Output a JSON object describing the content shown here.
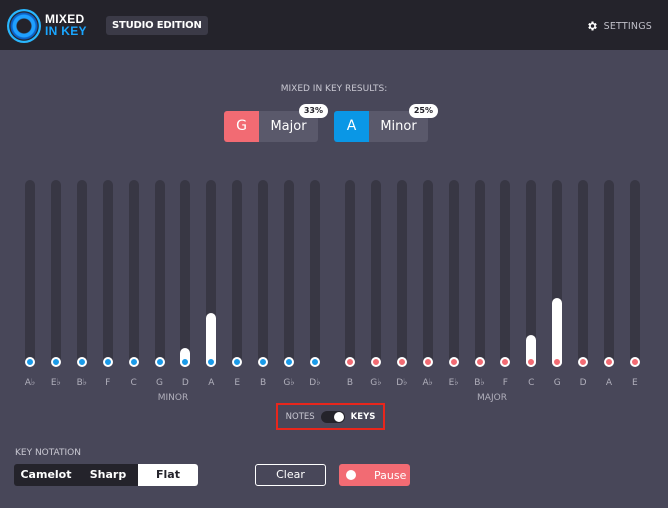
{
  "header": {
    "logo_line1": "MIXED",
    "logo_line2": "IN KEY",
    "edition": "STUDIO EDITION",
    "settings_label": "SETTINGS",
    "settings_icon": "gear-icon"
  },
  "results": {
    "title": "MIXED IN KEY RESULTS:",
    "cards": [
      {
        "note": "G",
        "mode": "Major",
        "percent": "33%",
        "color": "#f26b73"
      },
      {
        "note": "A",
        "mode": "Minor",
        "percent": "25%",
        "color": "#0a97e6"
      }
    ]
  },
  "minor": {
    "label": "MINOR",
    "dot_color": "#1a9ae8",
    "keys": [
      {
        "name": "A♭",
        "level": 0
      },
      {
        "name": "E♭",
        "level": 0
      },
      {
        "name": "B♭",
        "level": 0
      },
      {
        "name": "F",
        "level": 0
      },
      {
        "name": "C",
        "level": 0
      },
      {
        "name": "G",
        "level": 0
      },
      {
        "name": "D",
        "level": 0.1
      },
      {
        "name": "A",
        "level": 0.29
      },
      {
        "name": "E",
        "level": 0
      },
      {
        "name": "B",
        "level": 0
      },
      {
        "name": "G♭",
        "level": 0
      },
      {
        "name": "D♭",
        "level": 0
      }
    ]
  },
  "major": {
    "label": "MAJOR",
    "dot_color": "#f26b73",
    "keys": [
      {
        "name": "B",
        "level": 0
      },
      {
        "name": "G♭",
        "level": 0
      },
      {
        "name": "D♭",
        "level": 0
      },
      {
        "name": "A♭",
        "level": 0
      },
      {
        "name": "E♭",
        "level": 0
      },
      {
        "name": "B♭",
        "level": 0
      },
      {
        "name": "F",
        "level": 0
      },
      {
        "name": "C",
        "level": 0.17
      },
      {
        "name": "G",
        "level": 0.37
      },
      {
        "name": "D",
        "level": 0
      },
      {
        "name": "A",
        "level": 0
      },
      {
        "name": "E",
        "level": 0
      }
    ]
  },
  "view_toggle": {
    "left_label": "NOTES",
    "right_label": "KEYS",
    "selected": "KEYS"
  },
  "notation": {
    "title": "KEY NOTATION",
    "options": [
      "Camelot",
      "Sharp",
      "Flat"
    ],
    "selected": "Flat"
  },
  "actions": {
    "clear_label": "Clear",
    "pause_label": "Pause"
  }
}
